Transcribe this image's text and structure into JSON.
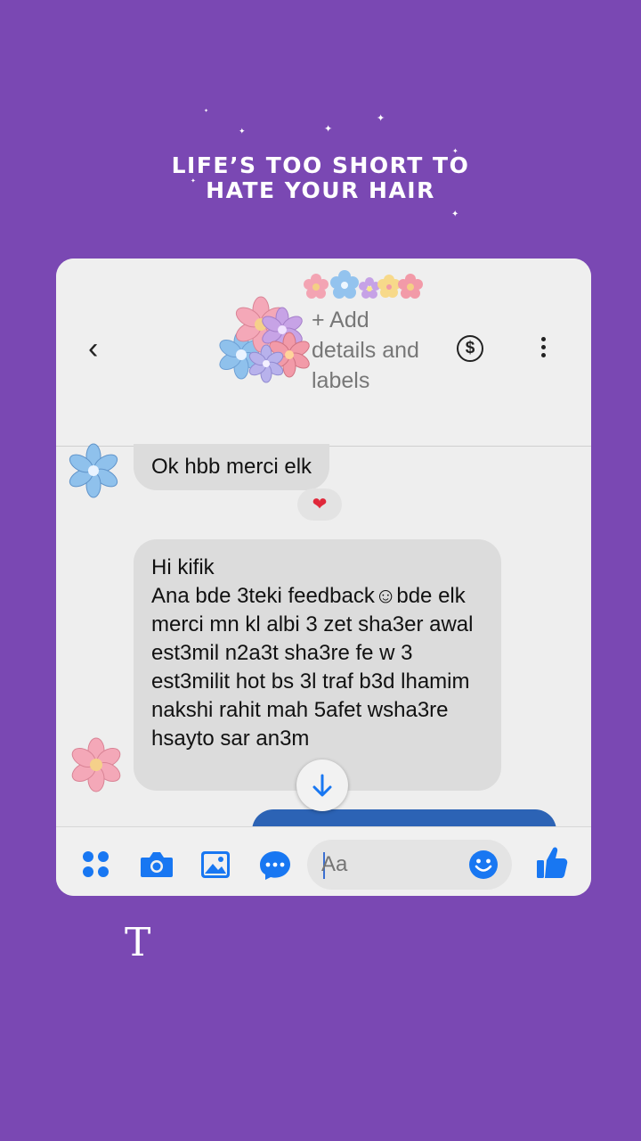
{
  "headline": {
    "line1": "LIFE’S TOO SHORT TO",
    "line2": "HATE YOUR HAIR"
  },
  "header": {
    "back_icon": "chevron-left-icon",
    "add_details": "+ Add details and labels",
    "payment_icon": "dollar-circle-icon",
    "menu_icon": "more-vertical-icon"
  },
  "messages": [
    {
      "sender": "contact",
      "text": "Ok hbb merci elk",
      "reaction": "❤"
    },
    {
      "sender": "contact",
      "text": "Hi kifik\nAna bde 3teki feedback☺bde elk merci mn kl albi 3 zet sha3er awal est3mil n2a3t sha3re fe w 3 est3milit hot bs 3l traf b3d lhamim nakshi rahit mah 5afet wsha3re hsayto sar an3m"
    }
  ],
  "composer": {
    "placeholder": "Aa",
    "icons": [
      "apps-icon",
      "camera-icon",
      "gallery-icon",
      "chat-bubble-icon",
      "emoji-icon",
      "thumbs-up-icon"
    ]
  },
  "watermark": "T",
  "colors": {
    "background": "#7a48b3",
    "accent": "#1877f2",
    "outgoing_bubble": "#2c63b5"
  }
}
